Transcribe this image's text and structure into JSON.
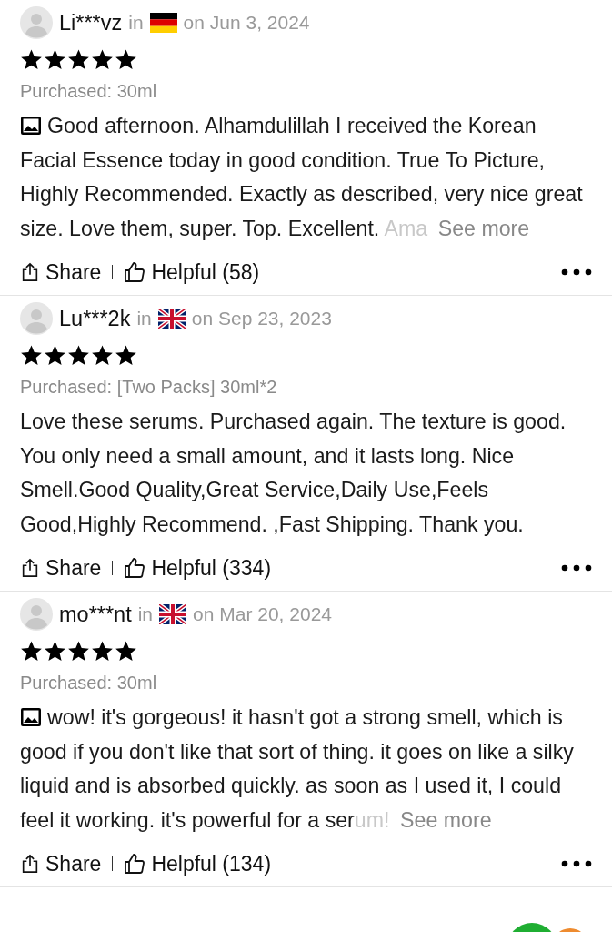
{
  "reviews": [
    {
      "user": "Li***vz",
      "in_label": "in",
      "flag": {
        "kind": "de"
      },
      "date": "on Jun 3, 2024",
      "stars": 5,
      "purchased": "Purchased: 30ml",
      "has_photo": true,
      "text": "Good afternoon. Alhamdulillah I received the Korean Facial Essence today in good condition. True To Picture, Highly Recommended. Exactly as described, very nice great size. Love them, super. Top. Excellent.",
      "faded_tail": " Ama",
      "see_more": "See more",
      "share": "Share",
      "helpful": "Helpful (58)"
    },
    {
      "user": "Lu***2k",
      "in_label": "in",
      "flag": {
        "kind": "gb"
      },
      "date": "on Sep 23, 2023",
      "stars": 5,
      "purchased": "Purchased: [Two Packs] 30ml*2",
      "has_photo": false,
      "text": "Love these serums. Purchased again. The texture is good. You only need a small amount, and it lasts long. Nice Smell.Good Quality,Great Service,Daily Use,Feels Good,Highly Recommend. ,Fast Shipping. Thank you.",
      "share": "Share",
      "helpful": "Helpful (334)"
    },
    {
      "user": "mo***nt",
      "in_label": "in",
      "flag": {
        "kind": "gb"
      },
      "date": "on Mar 20, 2024",
      "stars": 5,
      "purchased": "Purchased: 30ml",
      "has_photo": true,
      "text": "wow! it's gorgeous! it hasn't got a strong smell, which is good if you don't like that sort of thing. it goes on like a silky liquid and is absorbed quickly. as soon as I used it, I could feel it working. it's powerful for a ser",
      "faded_tail": "um!",
      "see_more": "See more",
      "share": "Share",
      "helpful": "Helpful (134)"
    }
  ]
}
